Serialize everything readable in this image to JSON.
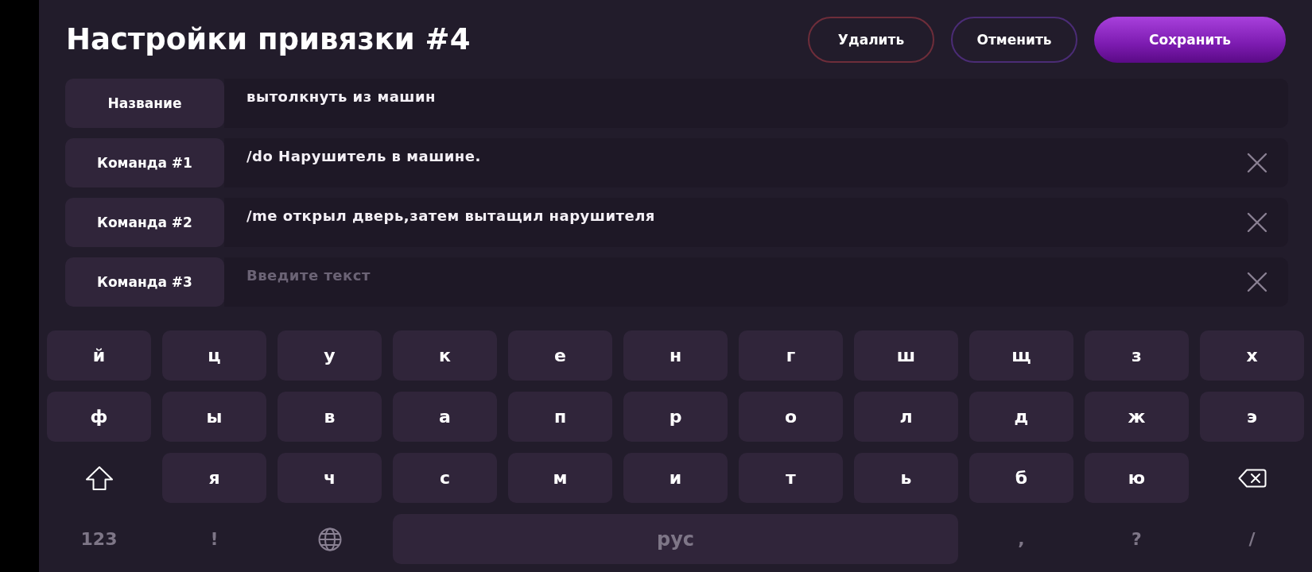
{
  "header": {
    "title": "Настройки привязки #4",
    "buttons": [
      {
        "label": "Удалить",
        "kind": "danger"
      },
      {
        "label": "Отменить",
        "kind": "outline"
      },
      {
        "label": "Сохранить",
        "kind": "primary"
      }
    ]
  },
  "fields": [
    {
      "label": "Название",
      "value": "вытолкнуть из машин",
      "clearable": false
    },
    {
      "label": "Команда #1",
      "value": "/do Нарушитель в машине.",
      "clearable": true
    },
    {
      "label": "Команда #2",
      "value": "/me открыл дверь,затем вытащил нарушителя",
      "clearable": true
    },
    {
      "label": "Команда #3",
      "placeholder": "Введите текст",
      "clearable": true
    }
  ],
  "keyboard": {
    "rows": [
      [
        {
          "kind": "letter",
          "label": "й"
        },
        {
          "kind": "letter",
          "label": "ц"
        },
        {
          "kind": "letter",
          "label": "у"
        },
        {
          "kind": "letter",
          "label": "к"
        },
        {
          "kind": "letter",
          "label": "е"
        },
        {
          "kind": "letter",
          "label": "н"
        },
        {
          "kind": "letter",
          "label": "г"
        },
        {
          "kind": "letter",
          "label": "ш"
        },
        {
          "kind": "letter",
          "label": "щ"
        },
        {
          "kind": "letter",
          "label": "з"
        },
        {
          "kind": "letter",
          "label": "х"
        }
      ],
      [
        {
          "kind": "letter",
          "label": "ф"
        },
        {
          "kind": "letter",
          "label": "ы"
        },
        {
          "kind": "letter",
          "label": "в"
        },
        {
          "kind": "letter",
          "label": "а"
        },
        {
          "kind": "letter",
          "label": "п"
        },
        {
          "kind": "letter",
          "label": "р"
        },
        {
          "kind": "letter",
          "label": "о"
        },
        {
          "kind": "letter",
          "label": "л"
        },
        {
          "kind": "letter",
          "label": "д"
        },
        {
          "kind": "letter",
          "label": "ж"
        },
        {
          "kind": "letter",
          "label": "э"
        }
      ],
      [
        {
          "kind": "shift"
        },
        {
          "kind": "letter",
          "label": "я"
        },
        {
          "kind": "letter",
          "label": "ч"
        },
        {
          "kind": "letter",
          "label": "с"
        },
        {
          "kind": "letter",
          "label": "м"
        },
        {
          "kind": "letter",
          "label": "и"
        },
        {
          "kind": "letter",
          "label": "т"
        },
        {
          "kind": "letter",
          "label": "ь"
        },
        {
          "kind": "letter",
          "label": "б"
        },
        {
          "kind": "letter",
          "label": "ю"
        },
        {
          "kind": "backspace"
        }
      ]
    ],
    "bottom_bar": [
      {
        "kind": "symbol",
        "label": "123"
      },
      {
        "kind": "symbol",
        "label": "!"
      },
      {
        "kind": "globe"
      },
      {
        "kind": "space",
        "label": "рус"
      },
      {
        "kind": "symbol",
        "label": ","
      },
      {
        "kind": "symbol",
        "label": "?"
      },
      {
        "kind": "symbol",
        "label": "/"
      }
    ]
  }
}
